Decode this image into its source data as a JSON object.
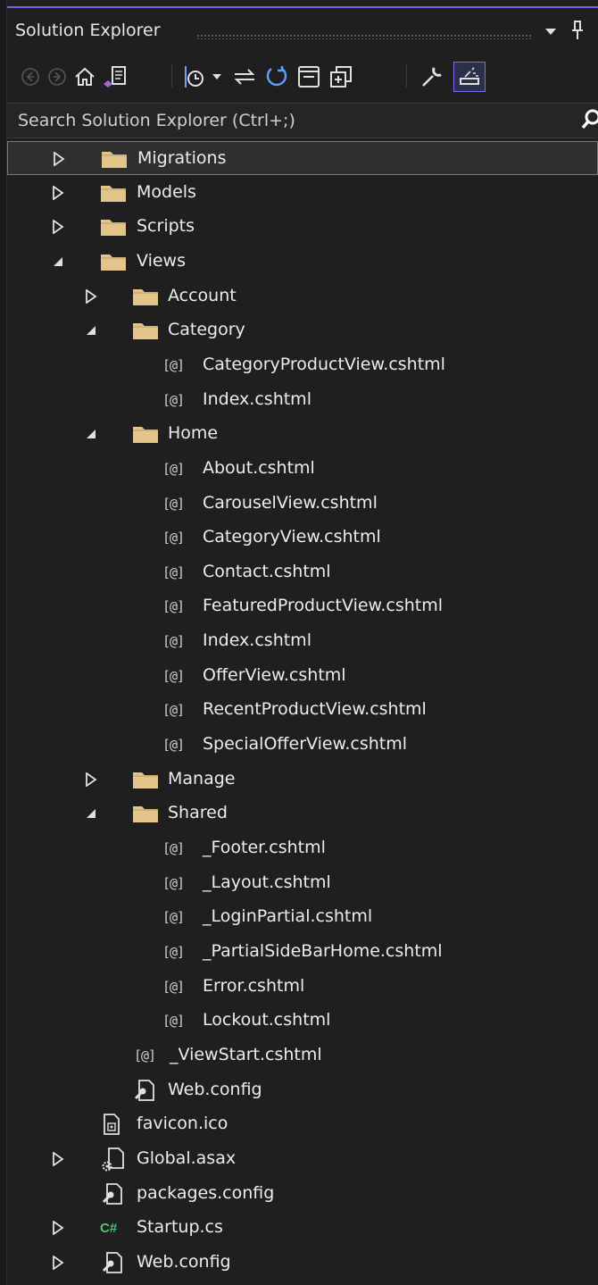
{
  "window": {
    "title": "Solution Explorer"
  },
  "search": {
    "placeholder": "Search Solution Explorer (Ctrl+;)"
  },
  "colors": {
    "accent": "#7160e8",
    "folder": "#e3c48a",
    "text": "#ececec",
    "csharp": "#4ec36a"
  },
  "toolbar": {
    "items": [
      "back-icon",
      "forward-icon",
      "home-icon",
      "switch-views-icon",
      "pending-changes-filter-icon",
      "dropdown-icon",
      "sync-with-active-document-icon",
      "refresh-icon",
      "collapse-all-icon",
      "show-all-files-icon",
      "properties-icon",
      "preview-selected-items-icon"
    ]
  },
  "tree": {
    "items": [
      {
        "label": "Migrations",
        "type": "folder",
        "expander": "collapsed",
        "selected": true
      },
      {
        "label": "Models",
        "type": "folder",
        "expander": "collapsed"
      },
      {
        "label": "Scripts",
        "type": "folder",
        "expander": "collapsed"
      },
      {
        "label": "Views",
        "type": "folder",
        "expander": "expanded"
      },
      {
        "label": "Account",
        "type": "folder",
        "expander": "collapsed"
      },
      {
        "label": "Category",
        "type": "folder",
        "expander": "expanded"
      },
      {
        "label": "CategoryProductView.cshtml",
        "type": "razor",
        "prefix": "[@]"
      },
      {
        "label": "Index.cshtml",
        "type": "razor",
        "prefix": "[@]"
      },
      {
        "label": "Home",
        "type": "folder",
        "expander": "expanded"
      },
      {
        "label": "About.cshtml",
        "type": "razor",
        "prefix": "[@]"
      },
      {
        "label": "CarouselView.cshtml",
        "type": "razor",
        "prefix": "[@]"
      },
      {
        "label": "CategoryView.cshtml",
        "type": "razor",
        "prefix": "[@]"
      },
      {
        "label": "Contact.cshtml",
        "type": "razor",
        "prefix": "[@]"
      },
      {
        "label": "FeaturedProductView.cshtml",
        "type": "razor",
        "prefix": "[@]"
      },
      {
        "label": "Index.cshtml",
        "type": "razor",
        "prefix": "[@]"
      },
      {
        "label": "OfferView.cshtml",
        "type": "razor",
        "prefix": "[@]"
      },
      {
        "label": "RecentProductView.cshtml",
        "type": "razor",
        "prefix": "[@]"
      },
      {
        "label": "SpecialOfferView.cshtml",
        "type": "razor",
        "prefix": "[@]"
      },
      {
        "label": "Manage",
        "type": "folder",
        "expander": "collapsed"
      },
      {
        "label": "Shared",
        "type": "folder",
        "expander": "expanded"
      },
      {
        "label": "_Footer.cshtml",
        "type": "razor",
        "prefix": "[@]"
      },
      {
        "label": "_Layout.cshtml",
        "type": "razor",
        "prefix": "[@]"
      },
      {
        "label": "_LoginPartial.cshtml",
        "type": "razor",
        "prefix": "[@]"
      },
      {
        "label": "_PartialSideBarHome.cshtml",
        "type": "razor",
        "prefix": "[@]"
      },
      {
        "label": "Error.cshtml",
        "type": "razor",
        "prefix": "[@]"
      },
      {
        "label": "Lockout.cshtml",
        "type": "razor",
        "prefix": "[@]"
      },
      {
        "label": "_ViewStart.cshtml",
        "type": "razor",
        "prefix": "[@]"
      },
      {
        "label": "Web.config",
        "type": "config"
      },
      {
        "label": "favicon.ico",
        "type": "ico"
      },
      {
        "label": "Global.asax",
        "type": "asax",
        "expander": "collapsed"
      },
      {
        "label": "packages.config",
        "type": "config"
      },
      {
        "label": "Startup.cs",
        "type": "cs",
        "expander": "collapsed",
        "prefix": "C#"
      },
      {
        "label": "Web.config",
        "type": "config",
        "expander": "collapsed"
      }
    ]
  }
}
